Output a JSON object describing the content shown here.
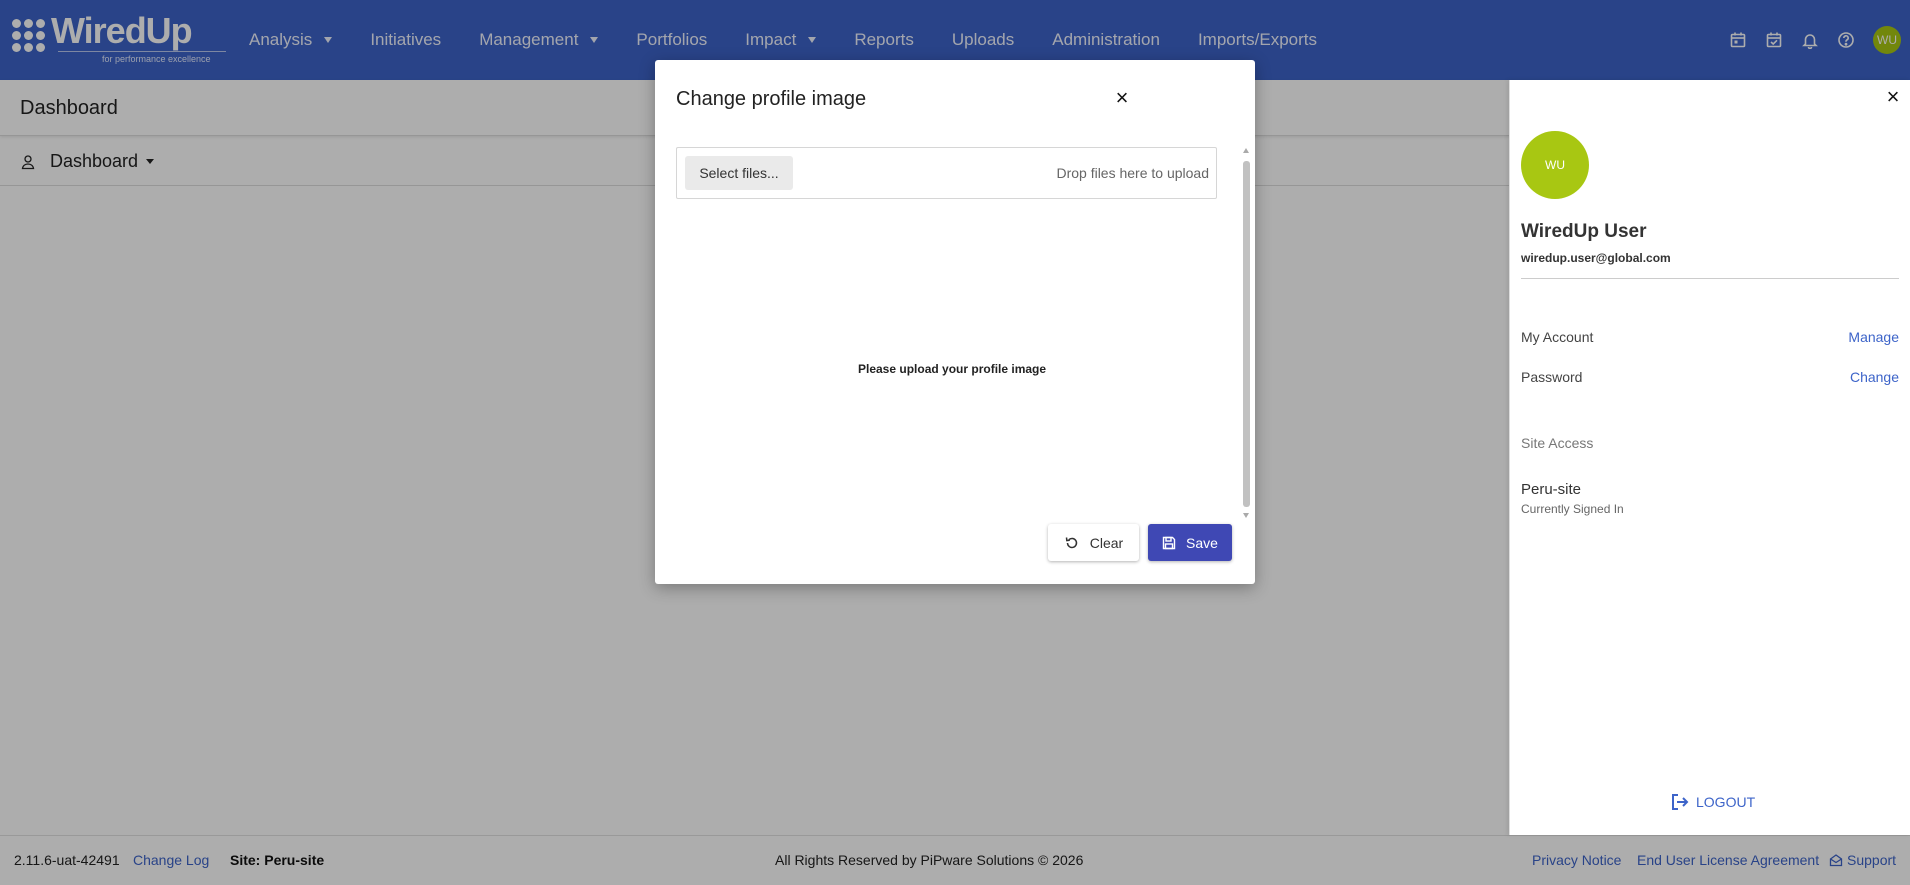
{
  "brand": {
    "name": "WiredUp",
    "tagline": "for performance excellence"
  },
  "nav": {
    "items": [
      {
        "label": "Analysis",
        "dropdown": true
      },
      {
        "label": "Initiatives",
        "dropdown": false
      },
      {
        "label": "Management",
        "dropdown": true
      },
      {
        "label": "Portfolios",
        "dropdown": false
      },
      {
        "label": "Impact",
        "dropdown": true
      },
      {
        "label": "Reports",
        "dropdown": false
      },
      {
        "label": "Uploads",
        "dropdown": false
      },
      {
        "label": "Administration",
        "dropdown": false
      },
      {
        "label": "Imports/Exports",
        "dropdown": false
      }
    ],
    "icons": [
      "calendar-icon",
      "calendar-check-icon",
      "bell-icon",
      "help-icon"
    ],
    "avatar_initials": "WU"
  },
  "page": {
    "title": "Dashboard",
    "dashboard_selector": "Dashboard"
  },
  "modal": {
    "title": "Change profile image",
    "select_files_label": "Select files...",
    "drop_hint": "Drop files here to upload",
    "empty_message": "Please upload your profile image",
    "clear_label": "Clear",
    "save_label": "Save"
  },
  "user_panel": {
    "avatar_initials": "WU",
    "name": "WiredUp User",
    "email": "wiredup.user@global.com",
    "my_account_label": "My Account",
    "manage_label": "Manage",
    "password_label": "Password",
    "change_label": "Change",
    "site_access_label": "Site Access",
    "site_name": "Peru-site",
    "site_status": "Currently Signed In",
    "logout_label": "LOGOUT"
  },
  "footer": {
    "version": "2.11.6-uat-42491",
    "change_log": "Change Log",
    "site": "Site: Peru-site",
    "rights": "All Rights Reserved by PiPware Solutions © 2026",
    "privacy": "Privacy Notice",
    "eula": "End User License Agreement",
    "support": "Support"
  },
  "colors": {
    "primary": "#3d64c9",
    "save_button": "#3f48b4",
    "avatar": "#a8c712"
  }
}
